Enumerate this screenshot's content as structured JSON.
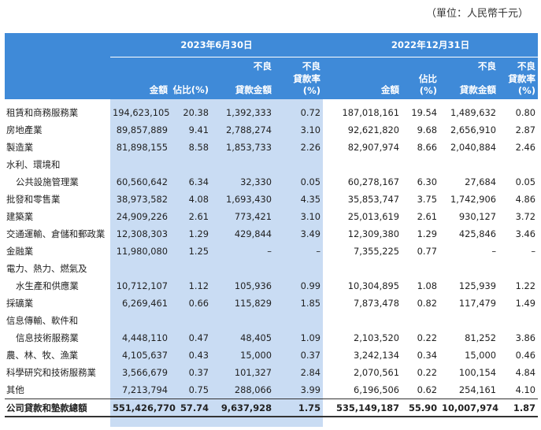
{
  "unit_note": "（單位：人民幣千元）",
  "headers": {
    "period1": "2023年6月30日",
    "period2": "2022年12月31日",
    "col_amount": "金額",
    "col_share": "佔比(%)",
    "col_npl_amount_l1": "不良",
    "col_npl_amount_l2": "貸款金額",
    "col_npl_ratio_l1": "不良",
    "col_npl_ratio_l2": "貸款率(%)"
  },
  "rows": [
    {
      "label": "租賃和商務服務業",
      "a1": "194,623,105",
      "s1": "20.38",
      "n1": "1,392,333",
      "r1": "0.72",
      "a2": "187,018,161",
      "s2": "19.54",
      "n2": "1,489,632",
      "r2": "0.80"
    },
    {
      "label": "房地產業",
      "a1": "89,857,889",
      "s1": "9.41",
      "n1": "2,788,274",
      "r1": "3.10",
      "a2": "92,621,820",
      "s2": "9.68",
      "n2": "2,656,910",
      "r2": "2.87"
    },
    {
      "label": "製造業",
      "a1": "81,898,155",
      "s1": "8.58",
      "n1": "1,853,733",
      "r1": "2.26",
      "a2": "82,907,974",
      "s2": "8.66",
      "n2": "2,040,884",
      "r2": "2.46"
    },
    {
      "label": "水利、環境和",
      "a1": "",
      "s1": "",
      "n1": "",
      "r1": "",
      "a2": "",
      "s2": "",
      "n2": "",
      "r2": ""
    },
    {
      "label": "公共設施管理業",
      "a1": "60,560,642",
      "s1": "6.34",
      "n1": "32,330",
      "r1": "0.05",
      "a2": "60,278,167",
      "s2": "6.30",
      "n2": "27,684",
      "r2": "0.05"
    },
    {
      "label": "批發和零售業",
      "a1": "38,973,582",
      "s1": "4.08",
      "n1": "1,693,430",
      "r1": "4.35",
      "a2": "35,853,747",
      "s2": "3.75",
      "n2": "1,742,906",
      "r2": "4.86"
    },
    {
      "label": "建築業",
      "a1": "24,909,226",
      "s1": "2.61",
      "n1": "773,421",
      "r1": "3.10",
      "a2": "25,013,619",
      "s2": "2.61",
      "n2": "930,127",
      "r2": "3.72"
    },
    {
      "label": "交通運輸、倉儲和郵政業",
      "a1": "12,308,303",
      "s1": "1.29",
      "n1": "429,844",
      "r1": "3.49",
      "a2": "12,309,380",
      "s2": "1.29",
      "n2": "425,846",
      "r2": "3.46"
    },
    {
      "label": "金融業",
      "a1": "11,980,080",
      "s1": "1.25",
      "n1": "–",
      "r1": "–",
      "a2": "7,355,225",
      "s2": "0.77",
      "n2": "–",
      "r2": "–"
    },
    {
      "label": "電力、熱力、燃氣及",
      "a1": "",
      "s1": "",
      "n1": "",
      "r1": "",
      "a2": "",
      "s2": "",
      "n2": "",
      "r2": ""
    },
    {
      "label": "水生產和供應業",
      "a1": "10,712,107",
      "s1": "1.12",
      "n1": "105,936",
      "r1": "0.99",
      "a2": "10,304,895",
      "s2": "1.08",
      "n2": "125,939",
      "r2": "1.22"
    },
    {
      "label": "採礦業",
      "a1": "6,269,461",
      "s1": "0.66",
      "n1": "115,829",
      "r1": "1.85",
      "a2": "7,873,478",
      "s2": "0.82",
      "n2": "117,479",
      "r2": "1.49"
    },
    {
      "label": "信息傳輸、軟件和",
      "a1": "",
      "s1": "",
      "n1": "",
      "r1": "",
      "a2": "",
      "s2": "",
      "n2": "",
      "r2": ""
    },
    {
      "label": "信息技術服務業",
      "a1": "4,448,110",
      "s1": "0.47",
      "n1": "48,405",
      "r1": "1.09",
      "a2": "2,103,520",
      "s2": "0.22",
      "n2": "81,252",
      "r2": "3.86"
    },
    {
      "label": "農、林、牧、漁業",
      "a1": "4,105,637",
      "s1": "0.43",
      "n1": "15,000",
      "r1": "0.37",
      "a2": "3,242,134",
      "s2": "0.34",
      "n2": "15,000",
      "r2": "0.46"
    },
    {
      "label": "科學研究和技術服務業",
      "a1": "3,566,679",
      "s1": "0.37",
      "n1": "101,327",
      "r1": "2.84",
      "a2": "2,070,561",
      "s2": "0.22",
      "n2": "100,154",
      "r2": "4.84"
    },
    {
      "label": "其他",
      "a1": "7,213,794",
      "s1": "0.75",
      "n1": "288,066",
      "r1": "3.99",
      "a2": "6,196,506",
      "s2": "0.62",
      "n2": "254,161",
      "r2": "4.10"
    }
  ],
  "total": {
    "label": "公司貸款和墊款總額",
    "a1": "551,426,770",
    "s1": "57.74",
    "n1": "9,637,928",
    "r1": "1.75",
    "a2": "535,149,187",
    "s2": "55.90",
    "n2": "10,007,974",
    "r2": "1.87"
  }
}
